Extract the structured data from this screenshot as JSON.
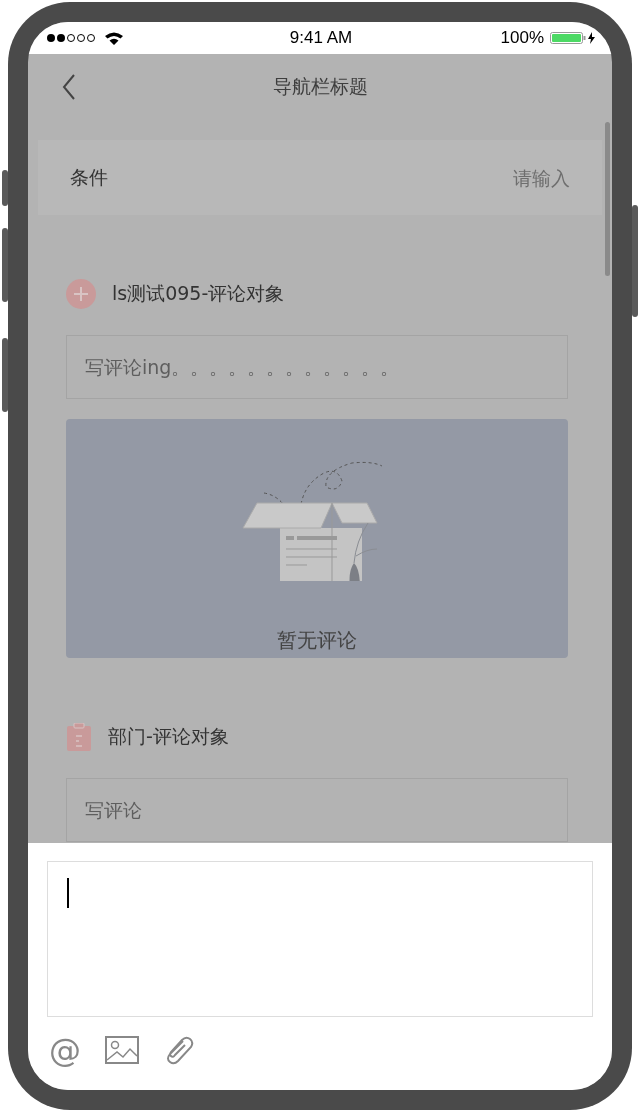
{
  "status_bar": {
    "time": "9:41 AM",
    "battery": "100%"
  },
  "nav": {
    "title": "导航栏标题"
  },
  "condition": {
    "label": "条件",
    "placeholder": "请输入"
  },
  "sections": [
    {
      "kind": "add",
      "title": "ls测试095-评论对象",
      "input": {
        "placeholder": "写评论ing。。。。。。。。。。。。"
      },
      "empty": {
        "text": "暂无评论"
      }
    },
    {
      "kind": "clipboard",
      "title": "部门-评论对象",
      "input": {
        "placeholder": "写评论"
      }
    }
  ],
  "composer": {
    "focused": true,
    "tools": [
      {
        "kind": "mention",
        "label": "@"
      },
      {
        "kind": "image"
      },
      {
        "kind": "attach"
      }
    ]
  }
}
